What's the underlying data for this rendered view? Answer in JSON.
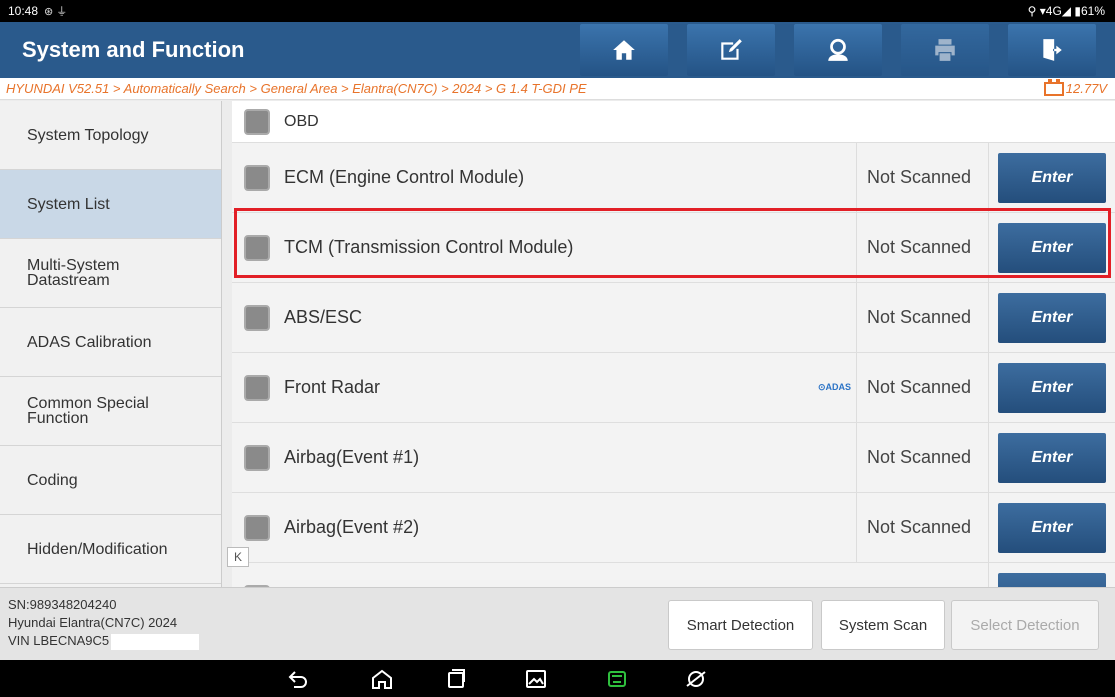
{
  "status_bar": {
    "time": "10:48",
    "right": "⚲ ▾4G◢ ▮61%"
  },
  "title_bar": {
    "title": "System and Function",
    "icons": [
      "home-icon",
      "edit-icon",
      "user-icon",
      "print-icon",
      "exit-icon"
    ]
  },
  "breadcrumb": {
    "path": "HYUNDAI V52.51 > Automatically Search > General Area > Elantra(CN7C) > 2024 > G 1.4 T-GDI PE",
    "voltage": "12.77V"
  },
  "sidebar": {
    "items": [
      {
        "label": "System Topology"
      },
      {
        "label": "System List"
      },
      {
        "label": "Multi-System\nDatastream"
      },
      {
        "label": "ADAS Calibration"
      },
      {
        "label": "Common Special\nFunction"
      },
      {
        "label": "Coding"
      },
      {
        "label": "Hidden/Modification"
      }
    ],
    "active_index": 1
  },
  "system_list": {
    "header": "OBD",
    "rows": [
      {
        "name": "ECM (Engine Control Module)",
        "status": "Not Scanned",
        "action": "Enter",
        "badge": ""
      },
      {
        "name": "TCM (Transmission Control Module)",
        "status": "Not Scanned",
        "action": "Enter",
        "badge": ""
      },
      {
        "name": "ABS/ESC",
        "status": "Not Scanned",
        "action": "Enter",
        "badge": ""
      },
      {
        "name": "Front Radar",
        "status": "Not Scanned",
        "action": "Enter",
        "badge": "⊙ADAS"
      },
      {
        "name": "Airbag(Event #1)",
        "status": "Not Scanned",
        "action": "Enter",
        "badge": ""
      },
      {
        "name": "Airbag(Event #2)",
        "status": "Not Scanned",
        "action": "Enter",
        "badge": ""
      }
    ],
    "highlighted_row": 1,
    "collapse_label": "K"
  },
  "footer": {
    "sn": "SN:989348204240",
    "vehicle": "Hyundai Elantra(CN7C) 2024",
    "vin": "VIN LBECNA9C5",
    "buttons": {
      "smart_detection": "Smart Detection",
      "system_scan": "System Scan",
      "select_detection": "Select Detection"
    }
  },
  "colors": {
    "title_bar": "#2a5a8c",
    "breadcrumb": "#e8732a",
    "highlight": "#e21f26",
    "enter_button": "#2f5f92"
  }
}
